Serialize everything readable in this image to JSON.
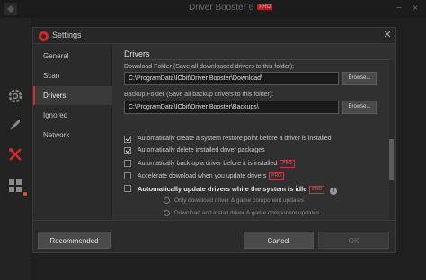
{
  "app": {
    "title": "Driver Booster 6",
    "badge": "PRO"
  },
  "window_controls": [
    "−",
    "×"
  ],
  "dialog": {
    "title": "Settings",
    "nav": [
      "General",
      "Scan",
      "Drivers",
      "Ignored",
      "Network"
    ],
    "active_nav": "Drivers",
    "section_title": "Drivers",
    "download_folder": {
      "label": "Download Folder (Save all downloaded drivers to this folder):",
      "value": "C:\\ProgramData\\IObit\\Driver Booster\\Download\\",
      "browse_label": "Browse..."
    },
    "backup_folder": {
      "label": "Backup Folder (Save all backup drivers to this folder):",
      "value": "C:\\ProgramData\\IObit\\Driver Booster\\Backups\\",
      "browse_label": "Browse..."
    },
    "options": [
      {
        "label": "Automatically create a system restore point before a driver is installed",
        "checked": true,
        "pro": ""
      },
      {
        "label": "Automatically delete installed driver packages",
        "checked": true,
        "pro": ""
      },
      {
        "label": "Automatically back up a driver before it is installed",
        "checked": false,
        "pro": "PRO"
      },
      {
        "label": "Accelerate download when you update drivers",
        "checked": false,
        "pro": "PRO"
      },
      {
        "label": "Automatically update drivers while the system is idle",
        "checked": false,
        "pro": "PRO"
      }
    ],
    "idle_suboptions": [
      "Only download driver & game component updates",
      "Download and install driver & game component updates"
    ],
    "buttons": {
      "recommended": "Recommended",
      "cancel": "Cancel",
      "ok": "OK"
    }
  },
  "colors": {
    "accent": "#d12a2a",
    "background": "#2b2b2b",
    "panel": "#303030"
  }
}
